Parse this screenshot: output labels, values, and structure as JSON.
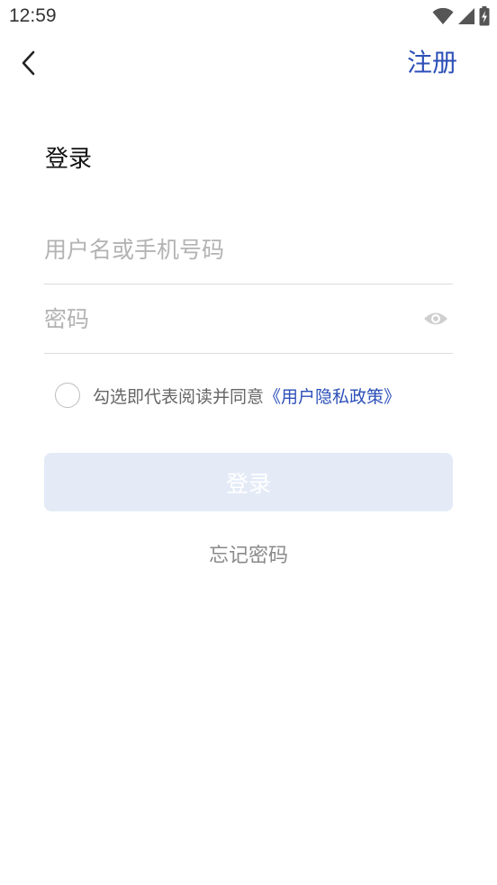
{
  "status_bar": {
    "time": "12:59",
    "icons": [
      "wifi-icon",
      "cellular-signal-icon",
      "battery-charging-icon"
    ]
  },
  "nav": {
    "back_icon": "chevron-left-icon",
    "register_label": "注册"
  },
  "form": {
    "title": "登录",
    "username": {
      "value": "",
      "placeholder": "用户名或手机号码"
    },
    "password": {
      "value": "",
      "placeholder": "密码",
      "toggle_icon": "eye-icon"
    },
    "agreement": {
      "checked": false,
      "text": "勾选即代表阅读并同意",
      "link_label": "《用户隐私政策》"
    },
    "login_label": "登录",
    "forgot_label": "忘记密码"
  },
  "colors": {
    "accent": "#2c4fb8",
    "login_button_disabled_bg": "#e4ebf7",
    "placeholder": "#b3b3b3",
    "divider": "#dcdcdc"
  }
}
